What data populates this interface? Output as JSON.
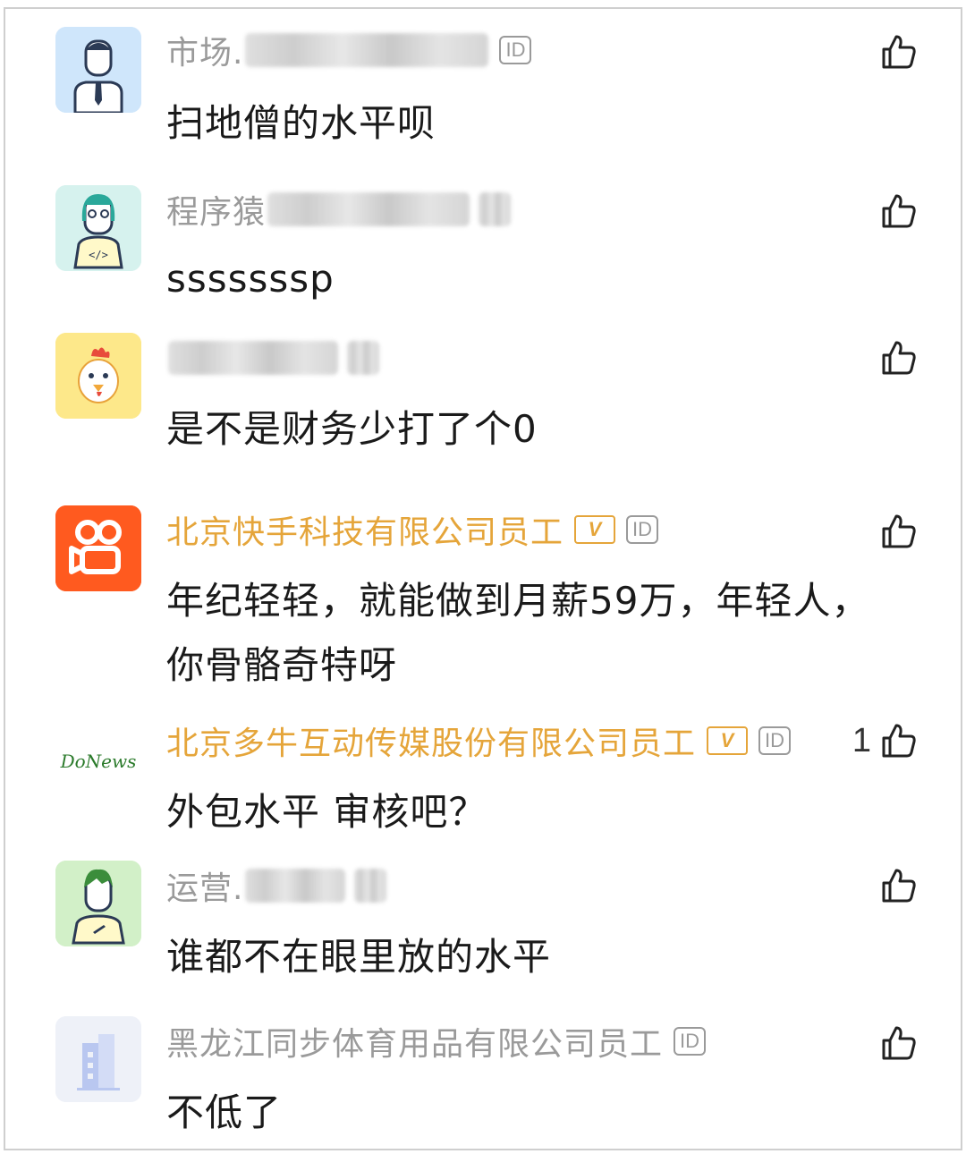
{
  "comments": [
    {
      "avatar": "businessman-avatar",
      "name": "市场.",
      "name_color": "#9a9a9a",
      "verified": false,
      "id_badge": "ID",
      "likes": "",
      "text": "扫地僧的水平呗"
    },
    {
      "avatar": "programmer-avatar",
      "name": "程序猿",
      "name_color": "#9a9a9a",
      "verified": false,
      "id_badge": "",
      "likes": "",
      "text": "sssssssp"
    },
    {
      "avatar": "chicken-avatar",
      "name": "",
      "name_color": "#9a9a9a",
      "verified": false,
      "id_badge": "",
      "likes": "",
      "text": "是不是财务少打了个0"
    },
    {
      "avatar": "kuaishou-logo-avatar",
      "name": "北京快手科技有限公司员工",
      "name_color": "#e5a53a",
      "verified": true,
      "verified_label": "V",
      "id_badge": "ID",
      "likes": "",
      "text": "年纪轻轻，就能做到月薪59万，年轻人，你骨骼奇特呀"
    },
    {
      "avatar": "donews-logo-avatar",
      "avatar_text": "DoNews",
      "name": "北京多牛互动传媒股份有限公司员工",
      "name_color": "#e5a53a",
      "verified": true,
      "verified_label": "V",
      "id_badge": "ID",
      "likes": "1",
      "text": "外包水平 审核吧？"
    },
    {
      "avatar": "operator-avatar",
      "name": "运营.",
      "name_color": "#9a9a9a",
      "verified": false,
      "id_badge": "",
      "likes": "",
      "text": "谁都不在眼里放的水平"
    },
    {
      "avatar": "company-building-avatar",
      "name": "黑龙江同步体育用品有限公司员工",
      "name_color": "#9a9a9a",
      "verified": false,
      "id_badge": "ID",
      "likes": "",
      "text": "不低了"
    }
  ],
  "icons": {
    "like": "thumbs-up-icon"
  },
  "colors": {
    "accent_gold": "#e5a53a",
    "muted_gray": "#9a9a9a",
    "kuaishou_orange": "#ff5a1f"
  }
}
